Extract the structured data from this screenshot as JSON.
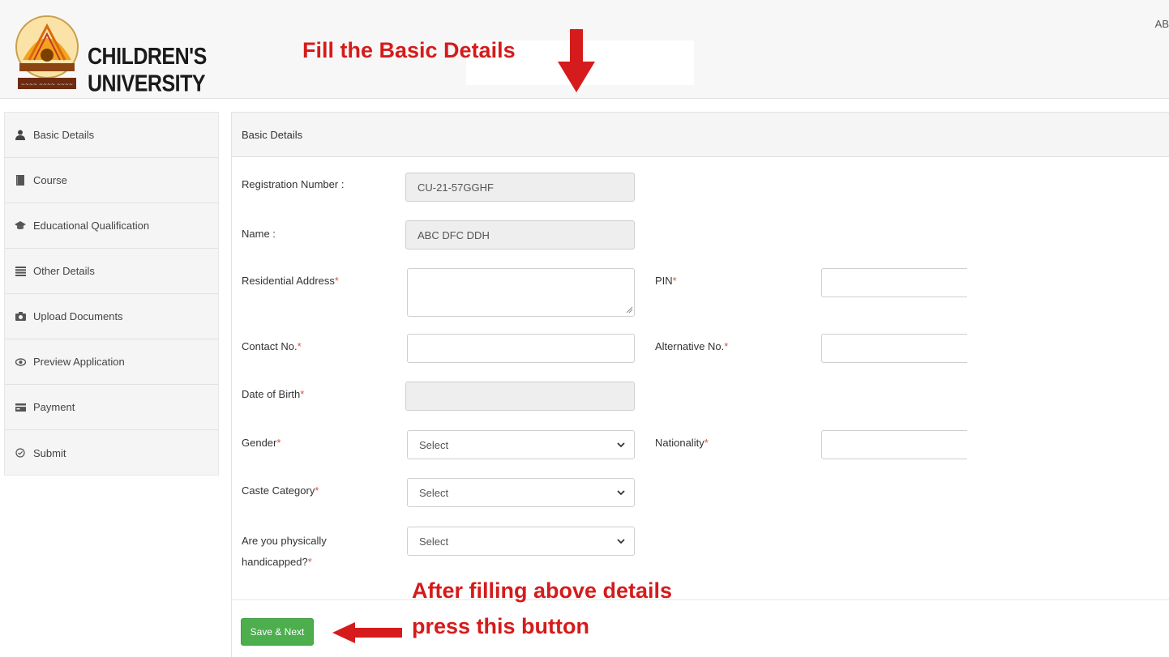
{
  "header": {
    "logo_text": "CHILDREN'S UNIVERSITY",
    "annotation": "Fill the Basic Details",
    "user_initials": "AB"
  },
  "sidebar": {
    "items": [
      {
        "label": "Basic Details",
        "icon": "user-icon"
      },
      {
        "label": "Course",
        "icon": "book-icon"
      },
      {
        "label": "Educational Qualification",
        "icon": "graduation-cap-icon"
      },
      {
        "label": "Other Details",
        "icon": "list-icon"
      },
      {
        "label": "Upload Documents",
        "icon": "camera-icon"
      },
      {
        "label": "Preview Application",
        "icon": "eye-icon"
      },
      {
        "label": "Payment",
        "icon": "credit-card-icon"
      },
      {
        "label": "Submit",
        "icon": "check-circle-icon"
      }
    ]
  },
  "panel": {
    "heading": "Basic Details"
  },
  "form": {
    "registration_number": {
      "label": "Registration Number :",
      "value": "CU-21-57GGHF"
    },
    "name": {
      "label": "Name :",
      "value": "ABC DFC DDH"
    },
    "residential_address": {
      "label": "Residential Address",
      "required": "*",
      "value": ""
    },
    "pin": {
      "label": "PIN",
      "required": "*",
      "value": ""
    },
    "contact_no": {
      "label": "Contact No.",
      "required": "*",
      "value": ""
    },
    "alternative_no": {
      "label": "Alternative No.",
      "required": "*",
      "value": ""
    },
    "date_of_birth": {
      "label": "Date of Birth",
      "required": "*",
      "value": ""
    },
    "gender": {
      "label": "Gender",
      "required": "*",
      "selected": "Select"
    },
    "nationality": {
      "label": "Nationality",
      "required": "*",
      "value": ""
    },
    "caste_category": {
      "label": "Caste Category",
      "required": "*",
      "selected": "Select"
    },
    "physically_handicapped": {
      "label_line1": "Are you physically",
      "label_line2": "handicapped?",
      "required": "*",
      "selected": "Select"
    }
  },
  "actions": {
    "save_next_label": "Save & Next",
    "annotation_line1": "After filling above details",
    "annotation_line2": "press this button"
  },
  "colors": {
    "annotation_red": "#d51b1b",
    "save_button_green": "#4cae4c",
    "required_red": "#d9534f"
  }
}
